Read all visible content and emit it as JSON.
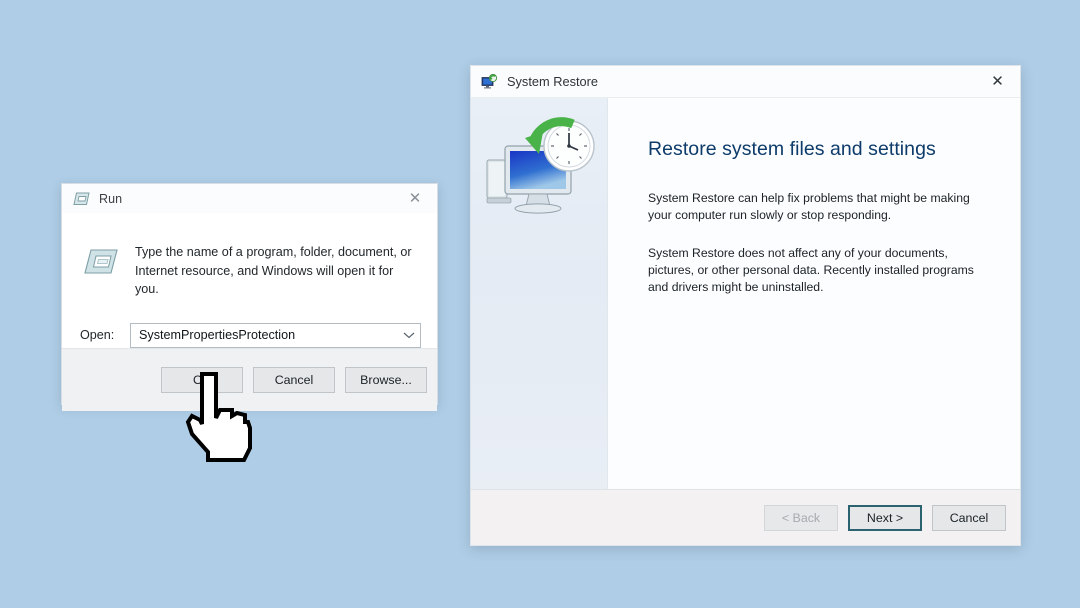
{
  "desktop": {
    "background_color": "#afcde6"
  },
  "run_dialog": {
    "title": "Run",
    "title_icon": "run-window-icon",
    "close_label": "✕",
    "description": "Type the name of a program, folder, document, or Internet resource, and Windows will open it for you.",
    "open_label": "Open:",
    "open_value": "SystemPropertiesProtection",
    "open_placeholder": "",
    "dropdown_icon": "chevron-down-icon",
    "buttons": [
      {
        "label": "OK",
        "state": "default"
      },
      {
        "label": "Cancel",
        "state": "default"
      },
      {
        "label": "Browse...",
        "state": "default"
      }
    ]
  },
  "system_restore": {
    "title": "System Restore",
    "title_icon": "system-restore-icon",
    "close_label": "✕",
    "sidebar_image": "computer-clock-restore-illustration",
    "heading": "Restore system files and settings",
    "paragraphs": [
      "System Restore can help fix problems that might be making your computer run slowly or stop responding.",
      "System Restore does not affect any of your documents, pictures, or other personal data. Recently installed programs and drivers might be uninstalled."
    ],
    "buttons": [
      {
        "label": "< Back",
        "state": "disabled"
      },
      {
        "label": "Next >",
        "state": "focused"
      },
      {
        "label": "Cancel",
        "state": "default"
      }
    ],
    "accent_color": "#2b6470",
    "heading_color": "#0d3b6b"
  },
  "cursor": {
    "type": "pointing-hand-cursor"
  }
}
